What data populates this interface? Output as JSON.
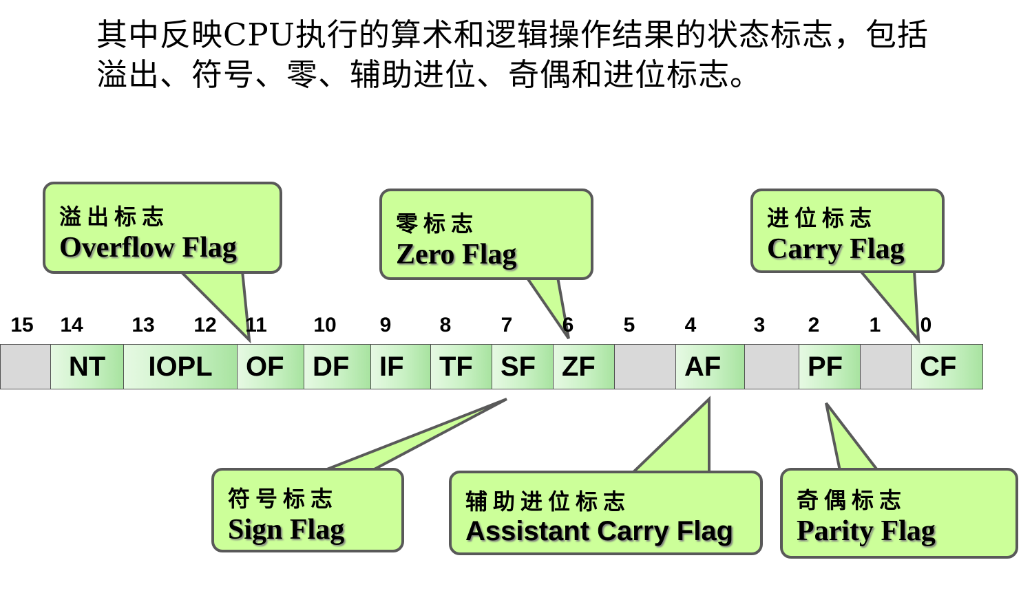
{
  "heading": {
    "line1": "其中反映CPU执行的算术和逻辑操作结果的状态标志，包括",
    "line2": "溢出、符号、零、辅助进位、奇偶和进位标志。"
  },
  "bit_numbers": [
    "15",
    "14",
    "13",
    "12",
    "11",
    "10",
    "9",
    "8",
    "7",
    "6",
    "5",
    "4",
    "3",
    "2",
    "1",
    "0"
  ],
  "register_fields": [
    "",
    "NT",
    "IOPL",
    "OF",
    "DF",
    "IF",
    "TF",
    "SF",
    "ZF",
    "",
    "AF",
    "",
    "PF",
    "",
    "CF"
  ],
  "callouts": {
    "overflow": {
      "cn": "溢出标志",
      "en": "Overflow Flag"
    },
    "zero": {
      "cn": "零标志",
      "en": "Zero Flag"
    },
    "carry": {
      "cn": "进位标志",
      "en": "Carry Flag"
    },
    "sign": {
      "cn": "符号标志",
      "en": "Sign Flag"
    },
    "assistant_carry": {
      "cn": "辅助进位标志",
      "en": "Assistant Carry Flag"
    },
    "parity": {
      "cn": "奇偶标志",
      "en": "Parity Flag"
    }
  },
  "colors": {
    "callout_fill": "#ccff99",
    "callout_border": "#595959",
    "reserved_cell": "#d9d9d9",
    "flag_cell": "#c9f1c4"
  }
}
